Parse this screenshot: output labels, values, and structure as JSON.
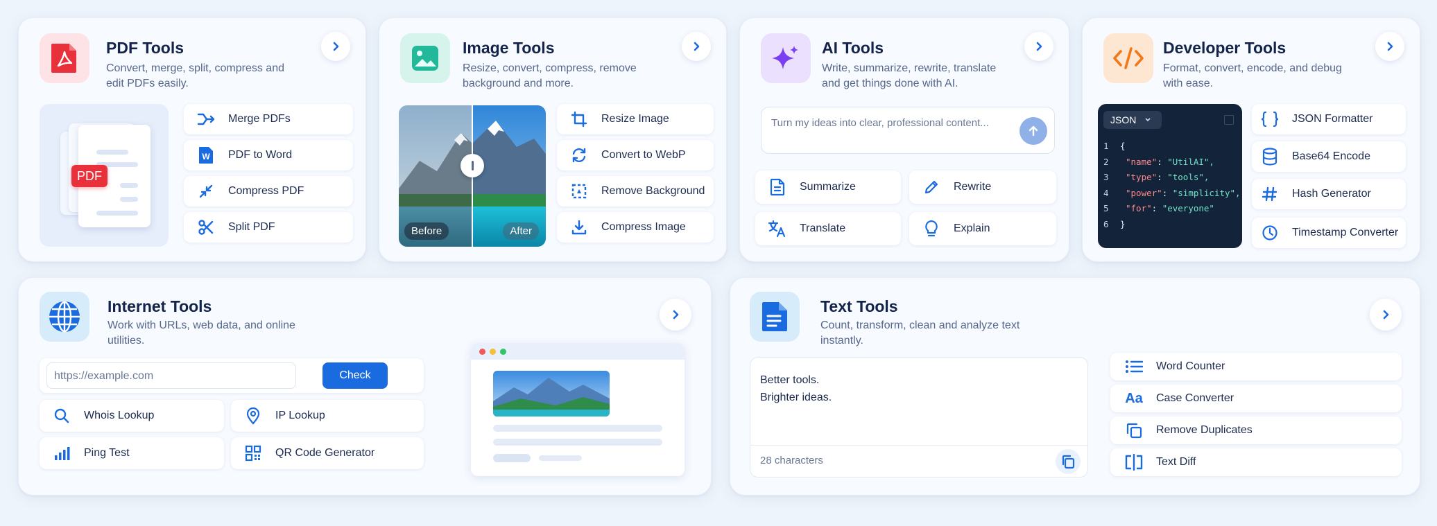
{
  "pdf": {
    "title": "PDF Tools",
    "desc_line1": "Convert, merge, split, compress and",
    "desc_line2": "edit PDFs easily.",
    "badge": "PDF",
    "items": [
      {
        "label": "Merge PDFs"
      },
      {
        "label": "PDF to Word"
      },
      {
        "label": "Compress PDF"
      },
      {
        "label": "Split PDF"
      }
    ]
  },
  "image": {
    "title": "Image Tools",
    "desc_line1": "Resize, convert, compress, remove",
    "desc_line2": "background and more.",
    "before_label": "Before",
    "after_label": "After",
    "items": [
      {
        "label": "Resize Image"
      },
      {
        "label": "Convert to WebP"
      },
      {
        "label": "Remove Background"
      },
      {
        "label": "Compress Image"
      }
    ]
  },
  "ai": {
    "title": "AI Tools",
    "desc_line1": "Write, summarize, rewrite, translate",
    "desc_line2": "and get things done with AI.",
    "prompt_placeholder": "Turn my ideas into clear, professional content...",
    "items": [
      {
        "label": "Summarize"
      },
      {
        "label": "Rewrite"
      },
      {
        "label": "Translate"
      },
      {
        "label": "Explain"
      }
    ]
  },
  "dev": {
    "title": "Developer Tools",
    "desc_line1": "Format, convert, encode, and debug",
    "desc_line2": "with ease.",
    "format_select": "JSON",
    "code": {
      "l1": "{",
      "name_key": "\"name\"",
      "name_val": "\"UtilAI\",",
      "type_key": "\"type\"",
      "type_val": "\"tools\",",
      "power_key": "\"power\"",
      "power_val": "\"simplicity\",",
      "for_key": "\"for\"",
      "for_val": "\"everyone\"",
      "l6": "}",
      "n1": "1",
      "n2": "2",
      "n3": "3",
      "n4": "4",
      "n5": "5",
      "n6": "6"
    },
    "items": [
      {
        "label": "JSON Formatter"
      },
      {
        "label": "Base64 Encode"
      },
      {
        "label": "Hash Generator"
      },
      {
        "label": "Timestamp Converter"
      }
    ]
  },
  "internet": {
    "title": "Internet Tools",
    "desc_line1": "Work with URLs, web data, and online",
    "desc_line2": "utilities.",
    "url_placeholder": "https://example.com",
    "check_label": "Check",
    "items": [
      {
        "label": "Whois Lookup"
      },
      {
        "label": "IP Lookup"
      },
      {
        "label": "Ping Test"
      },
      {
        "label": "QR Code Generator"
      }
    ]
  },
  "text": {
    "title": "Text Tools",
    "desc_line1": "Count, transform, clean and analyze text",
    "desc_line2": "instantly.",
    "editor_line1": "Better tools.",
    "editor_line2": "Brighter ideas.",
    "char_count": "28 characters",
    "items": [
      {
        "label": "Word Counter"
      },
      {
        "label": "Case Converter"
      },
      {
        "label": "Remove Duplicates"
      },
      {
        "label": "Text Diff"
      }
    ]
  },
  "colors": {
    "accent": "#1a6be0",
    "pdf_red": "#e8313a",
    "image_green": "#23b89a",
    "ai_purple": "#7b3ff2",
    "dev_orange": "#f07a1a",
    "code_bg": "#13233a"
  }
}
